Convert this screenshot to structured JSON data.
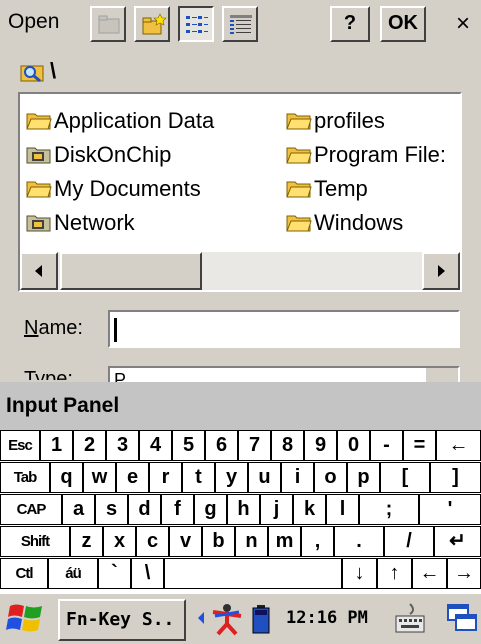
{
  "dialog": {
    "title": "Open",
    "help_label": "?",
    "ok_label": "OK",
    "close_label": "×",
    "toolbar_icons": [
      "up-folder-icon",
      "new-folder-icon",
      "list-view-icon",
      "details-view-icon"
    ]
  },
  "path": {
    "icon": "search-folder-icon",
    "text": "\\"
  },
  "files": {
    "col1": [
      {
        "name": "Application Data",
        "icon": "folder-icon"
      },
      {
        "name": "DiskOnChip",
        "icon": "storage-card-icon"
      },
      {
        "name": "My Documents",
        "icon": "folder-icon"
      },
      {
        "name": "Network",
        "icon": "storage-card-icon"
      }
    ],
    "col2": [
      {
        "name": "profiles",
        "icon": "folder-icon"
      },
      {
        "name": "Program File:",
        "icon": "folder-icon"
      },
      {
        "name": "Temp",
        "icon": "folder-icon"
      },
      {
        "name": "Windows",
        "icon": "folder-icon"
      }
    ]
  },
  "form": {
    "name_label_accel": "N",
    "name_label_rest": "ame:",
    "name_value": "",
    "type_label": "Type:",
    "type_value": "P"
  },
  "input_panel": {
    "title": "Input Panel",
    "rows": [
      [
        "Esc",
        "1",
        "2",
        "3",
        "4",
        "5",
        "6",
        "7",
        "8",
        "9",
        "0",
        "-",
        "=",
        "←"
      ],
      [
        "Tab",
        "q",
        "w",
        "e",
        "r",
        "t",
        "y",
        "u",
        "i",
        "o",
        "p",
        "[",
        "]"
      ],
      [
        "CAP",
        "a",
        "s",
        "d",
        "f",
        "g",
        "h",
        "j",
        "k",
        "l",
        ";",
        "'"
      ],
      [
        "Shift",
        "z",
        "x",
        "c",
        "v",
        "b",
        "n",
        "m",
        ",",
        ".",
        "/",
        "↵"
      ],
      [
        "Ctl",
        "áü",
        "`",
        "\\",
        "",
        "↓",
        "↑",
        "←",
        "→"
      ]
    ]
  },
  "taskbar": {
    "start_icon": "windows-flag-icon",
    "task_label": "Fn-Key S..",
    "clock": "12:16 PM",
    "tray_icons": [
      "tray-arrow-icon",
      "connectivity-icon",
      "battery-icon",
      "keyboard-icon",
      "desktop-icon"
    ]
  },
  "colors": {
    "face": "#d4d0c8",
    "folder": "#f0c040",
    "highlight": "#ffffff",
    "shadow": "#404040"
  }
}
